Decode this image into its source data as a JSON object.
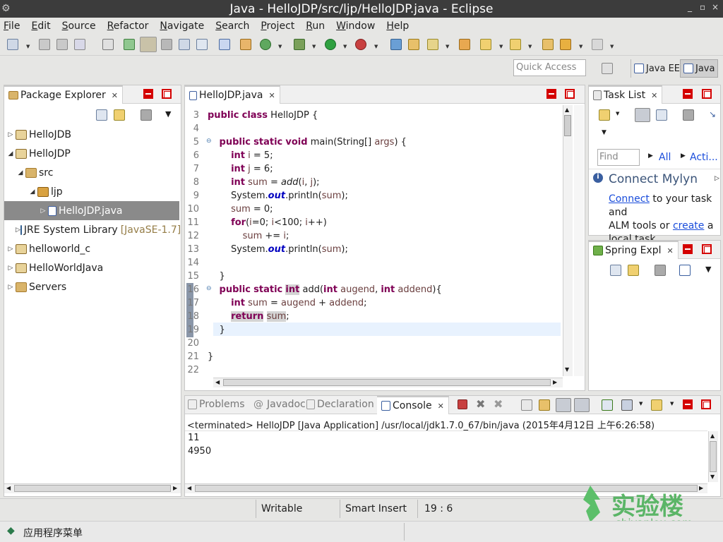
{
  "window": {
    "title": "Java - HelloJDP/src/ljp/HelloJDP.java - Eclipse",
    "controls": [
      "_",
      "▫",
      "×"
    ]
  },
  "menu": [
    "File",
    "Edit",
    "Source",
    "Refactor",
    "Navigate",
    "Search",
    "Project",
    "Run",
    "Window",
    "Help"
  ],
  "quick_access": {
    "placeholder": "Quick Access"
  },
  "perspectives": {
    "java_ee": "Java EE",
    "java": "Java"
  },
  "package_explorer": {
    "title": "Package Explorer",
    "items": [
      {
        "label": "HelloJDB",
        "depth": 0,
        "expanded": false,
        "type": "project"
      },
      {
        "label": "HelloJDP",
        "depth": 0,
        "expanded": true,
        "type": "project"
      },
      {
        "label": "src",
        "depth": 1,
        "expanded": true,
        "type": "folder"
      },
      {
        "label": "ljp",
        "depth": 2,
        "expanded": true,
        "type": "package"
      },
      {
        "label": "HelloJDP.java",
        "depth": 3,
        "expanded": false,
        "type": "java",
        "selected": true
      },
      {
        "label": "JRE System Library",
        "suffix": "[JavaSE-1.7]",
        "depth": 1,
        "expanded": false,
        "type": "lib"
      },
      {
        "label": "helloworld_c",
        "depth": 0,
        "expanded": false,
        "type": "project"
      },
      {
        "label": "HelloWorldJava",
        "depth": 0,
        "expanded": false,
        "type": "project"
      },
      {
        "label": "Servers",
        "depth": 0,
        "expanded": false,
        "type": "folder"
      }
    ]
  },
  "editor": {
    "tab": "HelloJDP.java",
    "line_numbers": [
      "3",
      "4",
      "5",
      "6",
      "7",
      "8",
      "9",
      "10",
      "11",
      "12",
      "13",
      "14",
      "15",
      "16",
      "17",
      "18",
      "19",
      "20",
      "21",
      "22"
    ]
  },
  "task_list": {
    "title": "Task List",
    "find_placeholder": "Find",
    "all": "All",
    "acti": "Acti...",
    "connect_title": "Connect Mylyn",
    "connect_link": "Connect",
    "connect_text1": " to your task and",
    "connect_text2": "ALM tools or ",
    "create_link": "create",
    "connect_text3": " a",
    "connect_text4": "local task."
  },
  "spring_explorer": {
    "title": "Spring Expl"
  },
  "bottom_tabs": {
    "problems": "Problems",
    "javadoc": "Javadoc",
    "declaration": "Declaration",
    "console": "Console"
  },
  "console": {
    "header": "<terminated> HelloJDP [Java Application] /usr/local/jdk1.7.0_67/bin/java (2015年4月12日 上午6:26:58)",
    "output": [
      "11",
      "4950"
    ]
  },
  "status": {
    "writable": "Writable",
    "insert_mode": "Smart Insert",
    "position": "19 : 6"
  },
  "taskbar": {
    "app_menu": "应用程序菜单"
  },
  "watermark": {
    "name": "实验楼",
    "url": "shiyanlou.com"
  }
}
